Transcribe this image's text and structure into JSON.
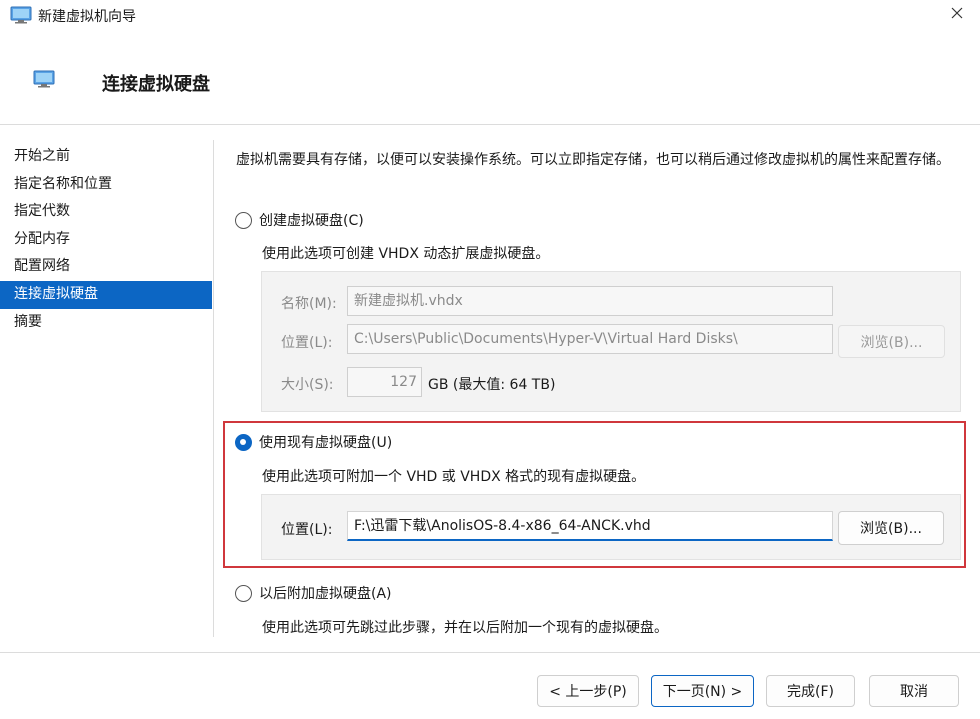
{
  "window": {
    "title": "新建虚拟机向导"
  },
  "header": {
    "title": "连接虚拟硬盘"
  },
  "sidebar": {
    "items": [
      {
        "label": "开始之前"
      },
      {
        "label": "指定名称和位置"
      },
      {
        "label": "指定代数"
      },
      {
        "label": "分配内存"
      },
      {
        "label": "配置网络"
      },
      {
        "label": "连接虚拟硬盘"
      },
      {
        "label": "摘要"
      }
    ],
    "active_index": 5
  },
  "main": {
    "description": "虚拟机需要具有存储，以便可以安装操作系统。可以立即指定存储，也可以稍后通过修改虚拟机的属性来配置存储。",
    "create": {
      "label": "创建虚拟硬盘(C)",
      "desc": "使用此选项可创建 VHDX 动态扩展虚拟硬盘。",
      "name_label": "名称(M):",
      "name_value": "新建虚拟机.vhdx",
      "location_label": "位置(L):",
      "location_value": "C:\\Users\\Public\\Documents\\Hyper-V\\Virtual Hard Disks\\",
      "browse_label": "浏览(B)...",
      "size_label": "大小(S):",
      "size_value": "127",
      "size_unit": "GB (最大值: 64 TB)"
    },
    "existing": {
      "label": "使用现有虚拟硬盘(U)",
      "desc": "使用此选项可附加一个 VHD 或 VHDX 格式的现有虚拟硬盘。",
      "location_label": "位置(L):",
      "location_value": "F:\\迅雷下载\\AnolisOS-8.4-x86_64-ANCK.vhd",
      "browse_label": "浏览(B)..."
    },
    "later": {
      "label": "以后附加虚拟硬盘(A)",
      "desc": "使用此选项可先跳过此步骤，并在以后附加一个现有的虚拟硬盘。"
    }
  },
  "footer": {
    "prev": "< 上一步(P)",
    "next": "下一页(N) >",
    "finish": "完成(F)",
    "cancel": "取消"
  },
  "colors": {
    "accent": "#0c66c4",
    "highlight": "#d0373c"
  }
}
